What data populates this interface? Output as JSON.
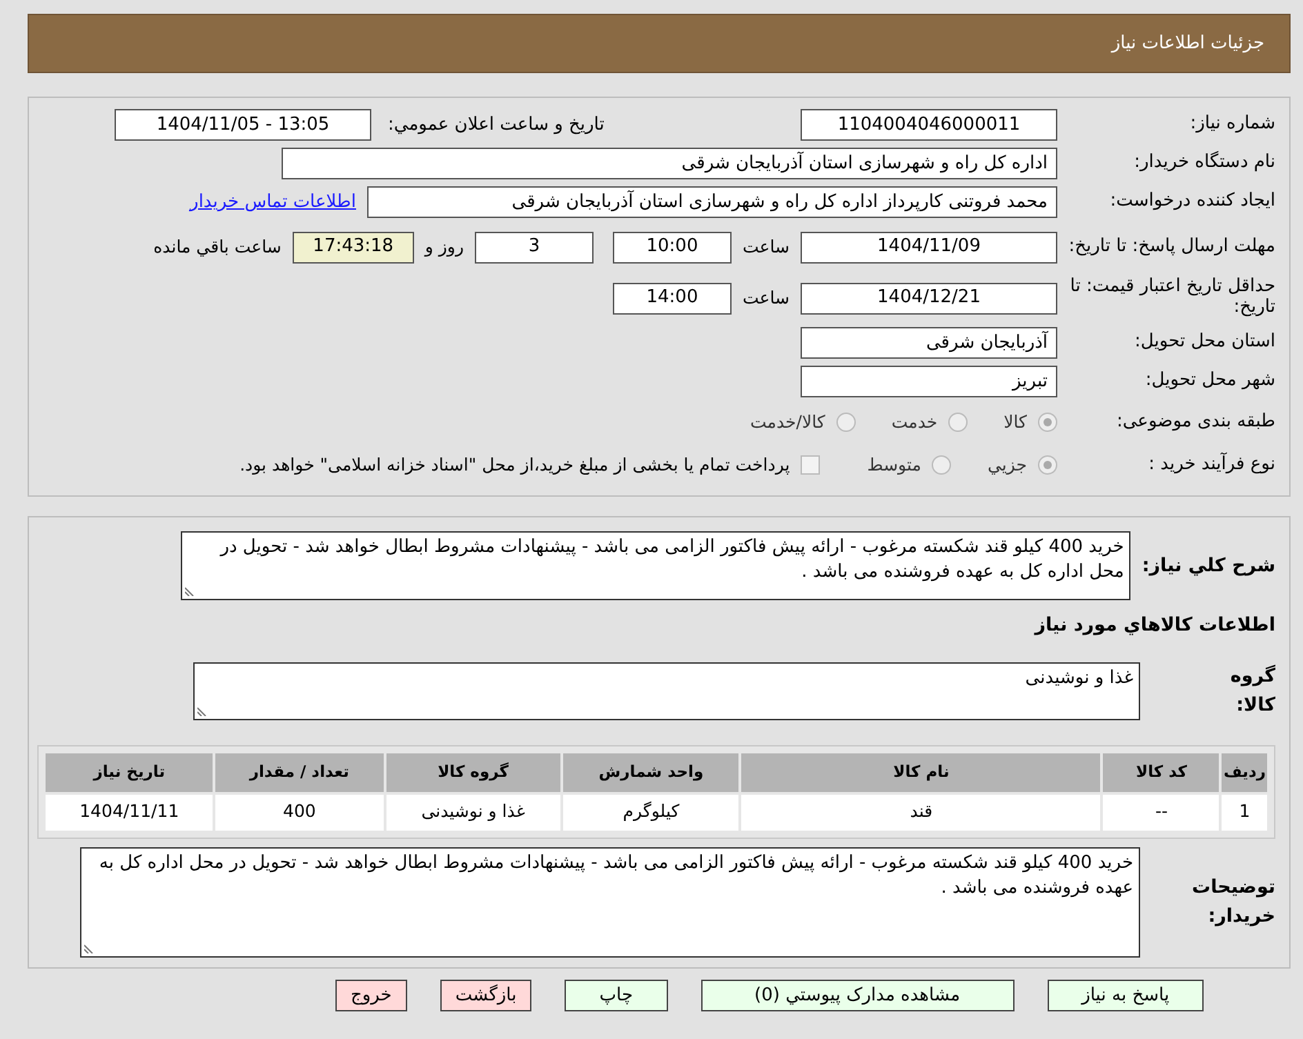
{
  "header": {
    "title": "جزئیات اطلاعات نیاز"
  },
  "need_number": {
    "label": "شماره نیاز:",
    "value": "1104004046000011"
  },
  "announce": {
    "label": "تاریخ و ساعت اعلان عمومي:",
    "value": "1404/11/05 - 13:05"
  },
  "buyer": {
    "label": "نام دستگاه خريدار:",
    "value": "اداره کل راه و شهرسازی استان آذربایجان شرقی"
  },
  "requester": {
    "label": "ایجاد کننده درخواست:",
    "value": "محمد فروتنی کارپرداز اداره کل راه و شهرسازی استان آذربایجان شرقی",
    "link": "اطلاعات تماس خریدار"
  },
  "deadline": {
    "label": "مهلت ارسال پاسخ: تا تاریخ:",
    "date": "1404/11/09",
    "time_label": "ساعت",
    "time": "10:00",
    "days": "3",
    "days_label": "روز و",
    "remaining": "17:43:18",
    "remaining_label": "ساعت باقي مانده"
  },
  "validity": {
    "label": "حداقل تاریخ اعتبار قیمت: تا تاریخ:",
    "date": "1404/12/21",
    "time_label": "ساعت",
    "time": "14:00"
  },
  "province": {
    "label": "استان محل تحویل:",
    "value": "آذربایجان شرقی"
  },
  "city": {
    "label": "شهر محل تحویل:",
    "value": "تبریز"
  },
  "category": {
    "label": "طبقه بندی موضوعی:",
    "options": [
      {
        "label": "کالا",
        "selected": true,
        "disabled": true
      },
      {
        "label": "خدمت",
        "selected": false,
        "disabled": true
      },
      {
        "label": "کالا/خدمت",
        "selected": false,
        "disabled": true
      }
    ]
  },
  "process": {
    "label": "نوع فرآیند خرید :",
    "options": [
      {
        "label": "جزيي",
        "selected": true,
        "disabled": true
      },
      {
        "label": "متوسط",
        "selected": false,
        "disabled": true
      }
    ],
    "checkbox": {
      "label": "پرداخت تمام یا بخشی از مبلغ خرید،از محل \"اسناد خزانه اسلامی\" خواهد بود.",
      "checked": false
    }
  },
  "description": {
    "label": "شرح کلي نیاز:",
    "text": "خرید 400 کیلو قند شکسته مرغوب - ارائه پیش فاکتور الزامی می باشد - پیشنهادات مشروط ابطال خواهد شد - تحویل در محل اداره کل به عهده فروشنده می باشد ."
  },
  "goods_title": "اطلاعات کالاهاي مورد نیاز",
  "goods_group": {
    "label": "گروه کالا:",
    "value": "غذا و نوشیدنی"
  },
  "table": {
    "columns": [
      "ردیف",
      "کد کالا",
      "نام کالا",
      "واحد شمارش",
      "گروه کالا",
      "تعداد / مقدار",
      "تاریخ نیاز"
    ],
    "rows": [
      [
        "1",
        "--",
        "قند",
        "کیلوگرم",
        "غذا و نوشیدنی",
        "400",
        "1404/11/11"
      ]
    ]
  },
  "buyer_notes": {
    "label": "توضیحات خریدار:",
    "text": "خرید 400 کیلو قند شکسته مرغوب - ارائه پیش فاکتور الزامی می باشد - پیشنهادات مشروط ابطال خواهد شد - تحویل در محل اداره کل به عهده فروشنده می باشد ."
  },
  "buttons": [
    {
      "label": "پاسخ به نیاز",
      "kind": "green"
    },
    {
      "label": "مشاهده مدارک پیوستي (0)",
      "kind": "green"
    },
    {
      "label": "چاپ",
      "kind": "green"
    },
    {
      "label": "بازگشت",
      "kind": "red"
    },
    {
      "label": "خروج",
      "kind": "red"
    }
  ]
}
